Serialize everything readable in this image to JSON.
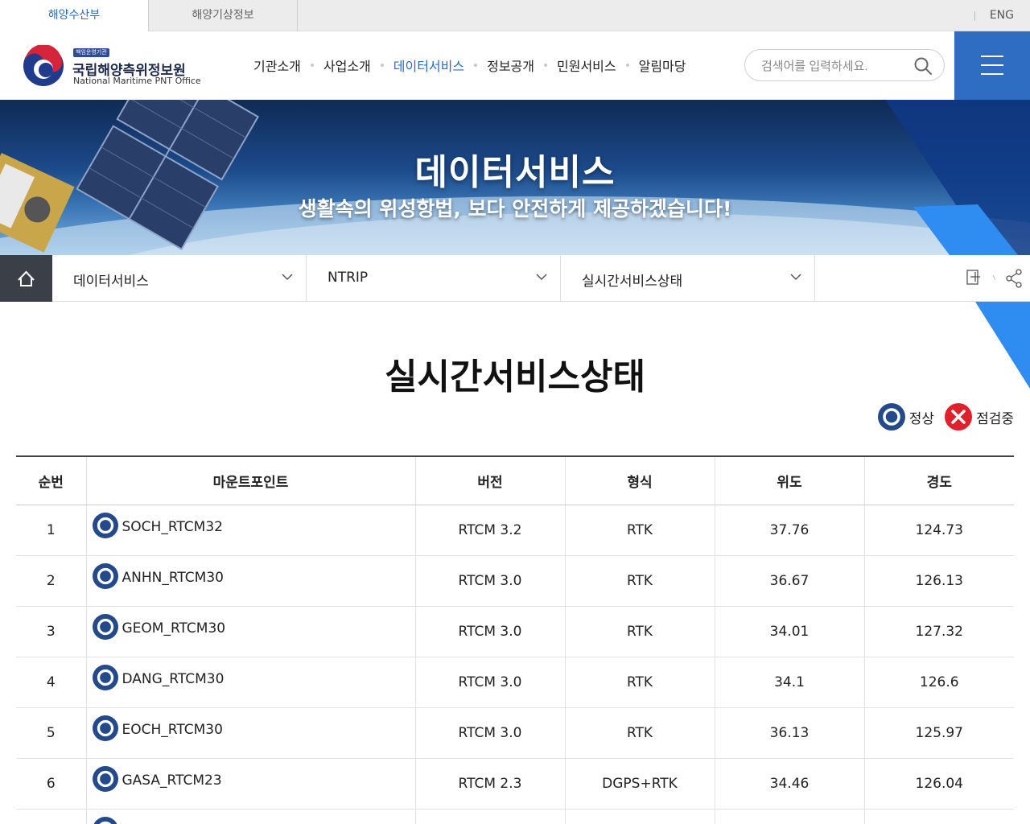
{
  "topbar": {
    "tabs": [
      {
        "label": "해양수산부",
        "active": true
      },
      {
        "label": "해양기상정보",
        "active": false
      }
    ],
    "lang": "ENG"
  },
  "header": {
    "logo_badge": "책임운영기관",
    "logo_kr": "국립해양측위정보원",
    "logo_en": "National Maritime PNT Office",
    "nav": [
      "기관소개",
      "사업소개",
      "데이터서비스",
      "정보공개",
      "민원서비스",
      "알림마당"
    ],
    "nav_active": "데이터서비스",
    "search_placeholder": "검색어를 입력하세요.",
    "accent": "#2e6dc1"
  },
  "banner": {
    "title": "데이터서비스",
    "subtitle": "생활속의 위성항법, 보다 안전하게 제공하겠습니다!"
  },
  "location": {
    "items": [
      "데이터서비스",
      "NTRIP",
      "실시간서비스상태"
    ],
    "icons": [
      "home-icon",
      "print-icon",
      "share-icon"
    ]
  },
  "content": {
    "title": "실시간서비스상태",
    "legend": [
      {
        "icon": "normal-status-icon",
        "label": "정상",
        "color": "#244a8c"
      },
      {
        "icon": "maintenance-status-icon",
        "label": "점검중",
        "color": "#e0202a"
      }
    ],
    "table": {
      "headers": [
        "순번",
        "마운트포인트",
        "버전",
        "형식",
        "위도",
        "경도"
      ],
      "rows": [
        {
          "no": "1",
          "mount": "SOCH_RTCM32",
          "version": "RTCM 3.2",
          "format": "RTK",
          "lat": "37.76",
          "lon": "124.73",
          "status": "normal"
        },
        {
          "no": "2",
          "mount": "ANHN_RTCM30",
          "version": "RTCM 3.0",
          "format": "RTK",
          "lat": "36.67",
          "lon": "126.13",
          "status": "normal"
        },
        {
          "no": "3",
          "mount": "GEOM_RTCM30",
          "version": "RTCM 3.0",
          "format": "RTK",
          "lat": "34.01",
          "lon": "127.32",
          "status": "normal"
        },
        {
          "no": "4",
          "mount": "DANG_RTCM30",
          "version": "RTCM 3.0",
          "format": "RTK",
          "lat": "34.1",
          "lon": "126.6",
          "status": "normal"
        },
        {
          "no": "5",
          "mount": "EOCH_RTCM30",
          "version": "RTCM 3.0",
          "format": "RTK",
          "lat": "36.13",
          "lon": "125.97",
          "status": "normal"
        },
        {
          "no": "6",
          "mount": "GASA_RTCM23",
          "version": "RTCM 2.3",
          "format": "DGPS+RTK",
          "lat": "34.46",
          "lon": "126.04",
          "status": "normal"
        }
      ]
    }
  }
}
